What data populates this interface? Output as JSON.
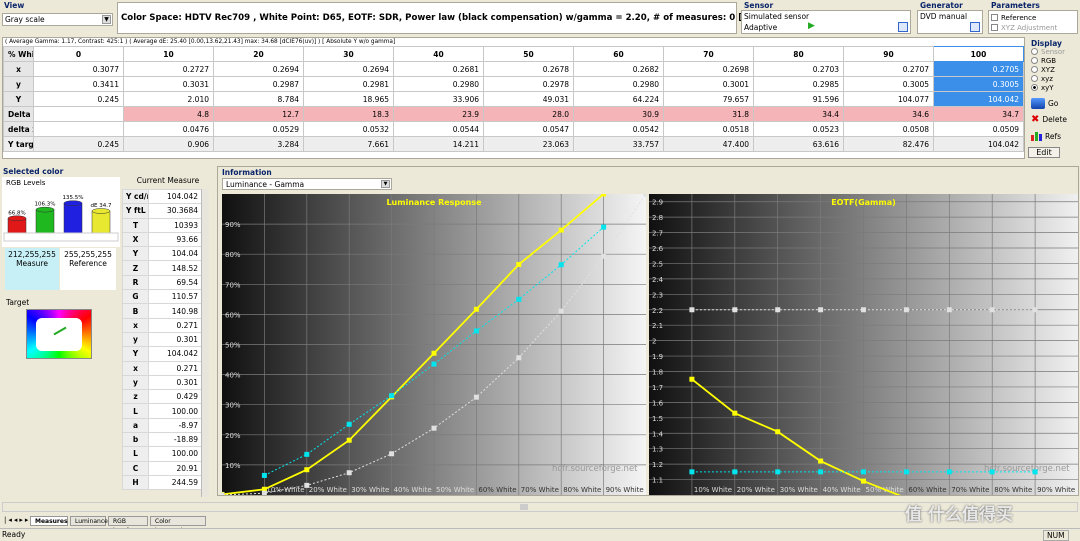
{
  "view": {
    "title": "View",
    "dropdown": "Gray scale"
  },
  "info_line": "Color Space: HDTV Rec709 , White Point: D65, EOTF:  SDR, Power law (black compensation) w/gamma = 2.20, # of measures: 0 [15:28:46]",
  "sensor": {
    "title": "Sensor",
    "name": "Simulated sensor",
    "mode": "Adaptive"
  },
  "generator": {
    "title": "Generator",
    "name": "DVD manual"
  },
  "parameters": {
    "title": "Parameters",
    "reference": "Reference",
    "xyz_adjust": "XYZ Adjustment"
  },
  "summary": "( Average Gamma: 1.17, Contrast: 425:1 ) ( Average dE: 25.40 [0.00,13.62,21.43] max: 34.68 [dCIE76(uv)] ) [ Absolute Y w/o gamma]",
  "grid": {
    "headers": [
      "% White",
      "0",
      "10",
      "20",
      "30",
      "40",
      "50",
      "60",
      "70",
      "80",
      "90",
      "100"
    ],
    "rows": [
      {
        "label": "x",
        "values": [
          "0.3077",
          "0.2727",
          "0.2694",
          "0.2694",
          "0.2681",
          "0.2678",
          "0.2682",
          "0.2698",
          "0.2703",
          "0.2707",
          "0.2705"
        ]
      },
      {
        "label": "y",
        "values": [
          "0.3411",
          "0.3031",
          "0.2987",
          "0.2981",
          "0.2980",
          "0.2978",
          "0.2980",
          "0.3001",
          "0.2985",
          "0.3005",
          "0.3005"
        ]
      },
      {
        "label": "Y",
        "values": [
          "0.245",
          "2.010",
          "8.784",
          "18.965",
          "33.906",
          "49.031",
          "64.224",
          "79.657",
          "91.596",
          "104.077",
          "104.042"
        ]
      },
      {
        "label": "Delta E",
        "values": [
          "",
          "4.8",
          "12.7",
          "18.3",
          "23.9",
          "28.0",
          "30.9",
          "31.8",
          "34.4",
          "34.6",
          "34.7"
        ]
      },
      {
        "label": "delta xy",
        "values": [
          "",
          "0.0476",
          "0.0529",
          "0.0532",
          "0.0544",
          "0.0547",
          "0.0542",
          "0.0518",
          "0.0523",
          "0.0508",
          "0.0509"
        ]
      },
      {
        "label": "Y target",
        "values": [
          "0.245",
          "0.906",
          "3.284",
          "7.661",
          "14.211",
          "23.063",
          "33.757",
          "47.400",
          "63.616",
          "82.476",
          "104.042"
        ]
      }
    ]
  },
  "display": {
    "title": "Display",
    "options": [
      "Sensor",
      "RGB",
      "XYZ",
      "xyz",
      "xyY"
    ],
    "selected": "xyY"
  },
  "side_buttons": {
    "go": "Go",
    "delete": "Delete",
    "refs": "Refs",
    "edit": "Edit"
  },
  "selected_color": {
    "title": "Selected color",
    "rgb_title": "RGB Levels",
    "bars": [
      {
        "label": "66.8%",
        "value": 66.8,
        "color": "#e01818"
      },
      {
        "label": "106.3%",
        "value": 106.3,
        "color": "#1fb81f"
      },
      {
        "label": "135.5%",
        "value": 135.5,
        "color": "#2020e0"
      },
      {
        "label": "dE 34.7",
        "value": 100,
        "color": "#e8e830"
      }
    ],
    "measure": "212,255,255",
    "measure_label": "Measure",
    "reference": "255,255,255",
    "reference_label": "Reference",
    "target": "Target"
  },
  "current_measure": {
    "title": "Current Measure",
    "rows": [
      [
        "Y cd/m",
        "104.042"
      ],
      [
        "Y ftL",
        "30.3684"
      ],
      [
        "T",
        "10393"
      ],
      [
        "X",
        "93.66"
      ],
      [
        "Y",
        "104.04"
      ],
      [
        "Z",
        "148.52"
      ],
      [
        "R",
        "69.54"
      ],
      [
        "G",
        "110.57"
      ],
      [
        "B",
        "140.98"
      ],
      [
        "x",
        "0.271"
      ],
      [
        "y",
        "0.301"
      ],
      [
        "Y",
        "104.042"
      ],
      [
        "x",
        "0.271"
      ],
      [
        "y",
        "0.301"
      ],
      [
        "z",
        "0.429"
      ],
      [
        "L",
        "100.00"
      ],
      [
        "a",
        "-8.97"
      ],
      [
        "b",
        "-18.89"
      ],
      [
        "L",
        "100.00"
      ],
      [
        "C",
        "20.91"
      ],
      [
        "H",
        "244.59"
      ]
    ]
  },
  "information": {
    "title": "Information",
    "dropdown": "Luminance - Gamma"
  },
  "chart_data": [
    {
      "type": "line",
      "title": "Luminance Response",
      "x_tick_labels": [
        "10% White",
        "20% White",
        "30% White",
        "40% White",
        "50% White",
        "60% White",
        "70% White",
        "80% White",
        "90% White"
      ],
      "y_tick_labels": [
        "10%",
        "20%",
        "30%",
        "40%",
        "50%",
        "60%",
        "70%",
        "80%",
        "90%"
      ],
      "ylim": [
        0,
        100
      ],
      "xlim": [
        0,
        100
      ],
      "watermark": "hcfr.sourceforge.net",
      "series": [
        {
          "color": "#ffff00",
          "x": [
            0,
            10,
            20,
            30,
            40,
            50,
            60,
            70,
            80,
            90
          ],
          "y": [
            0.2,
            1.9,
            8.4,
            18.2,
            32.6,
            47.1,
            61.7,
            76.6,
            88.0,
            100
          ]
        },
        {
          "color": "#00e5ee",
          "x": [
            10,
            20,
            30,
            40,
            50,
            60,
            70,
            80,
            90
          ],
          "y": [
            6.5,
            13.5,
            23.5,
            33,
            43.5,
            54.5,
            65,
            76.5,
            89
          ]
        },
        {
          "color": "#e0e0e0",
          "x": [
            0,
            10,
            20,
            30,
            40,
            50,
            60,
            70,
            80,
            90,
            100
          ],
          "y": [
            0,
            0.6,
            3.2,
            7.4,
            13.7,
            22.2,
            32.5,
            45.6,
            61.1,
            79.3,
            100
          ]
        }
      ]
    },
    {
      "type": "line",
      "title": "EOTF(Gamma)",
      "x_tick_labels": [
        "10% White",
        "20% White",
        "30% White",
        "40% White",
        "50% White",
        "60% White",
        "70% White",
        "80% White",
        "90% White"
      ],
      "y_tick_labels": [
        "1.1",
        "1.2",
        "1.3",
        "1.4",
        "1.5",
        "1.6",
        "1.7",
        "1.8",
        "1.9",
        "2",
        "2.1",
        "2.2",
        "2.3",
        "2.4",
        "2.5",
        "2.6",
        "2.7",
        "2.8",
        "2.9"
      ],
      "ylim": [
        1.0,
        2.95
      ],
      "xlim": [
        0,
        100
      ],
      "watermark": "hcfr.sourceforge.net",
      "series": [
        {
          "color": "#ffff00",
          "x": [
            10,
            20,
            30,
            40,
            50,
            60,
            70,
            80,
            90
          ],
          "y": [
            1.75,
            1.53,
            1.41,
            1.22,
            1.09,
            0.98,
            0.87,
            0.78,
            0.7
          ]
        },
        {
          "color": "#00e5ee",
          "x": [
            10,
            20,
            30,
            40,
            50,
            60,
            70,
            80,
            90
          ],
          "y": [
            1.15,
            1.15,
            1.15,
            1.15,
            1.15,
            1.15,
            1.15,
            1.15,
            1.15
          ]
        },
        {
          "color": "#e0e0e0",
          "x": [
            10,
            20,
            30,
            40,
            50,
            60,
            70,
            80,
            90
          ],
          "y": [
            2.2,
            2.2,
            2.2,
            2.2,
            2.2,
            2.2,
            2.2,
            2.2,
            2.2
          ]
        }
      ]
    }
  ],
  "tabs": [
    "Measures",
    "Luminance",
    "RGB Levels",
    "Color temperature"
  ],
  "status": {
    "left": "Ready",
    "right": "NUM"
  },
  "watermark_brand": "值 什么值得买"
}
